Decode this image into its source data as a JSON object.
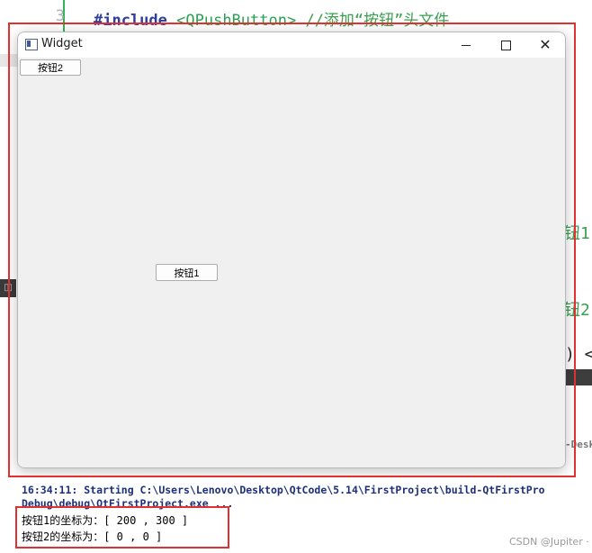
{
  "editor": {
    "line_number": "3",
    "include_kw": "#include",
    "include_header": "<QPushButton>",
    "include_comment": "//添加“按钮”头文件",
    "frag_1": "钮1",
    "frag_2": "钮2",
    "frag_3": ") <",
    "build_dir_fragment": "-Desk"
  },
  "window": {
    "title": "Widget",
    "close_glyph": "✕"
  },
  "buttons": {
    "button2_label": "按钮2",
    "button1_label": "按钮1"
  },
  "output": {
    "line1": "16:34:11: Starting C:\\Users\\Lenovo\\Desktop\\QtCode\\5.14\\FirstProject\\build-QtFirstPro",
    "line2": "Debug\\debug\\QtFirstProject.exe ...",
    "line3": "按钮1的坐标为：[ 200 , 300 ]",
    "line4": "按钮2的坐标为：[ 0 , 0 ]"
  },
  "watermark": "CSDN @Jupiter ·",
  "colors": {
    "highlight": "#e03030",
    "output_text": "#1c2f7a"
  }
}
